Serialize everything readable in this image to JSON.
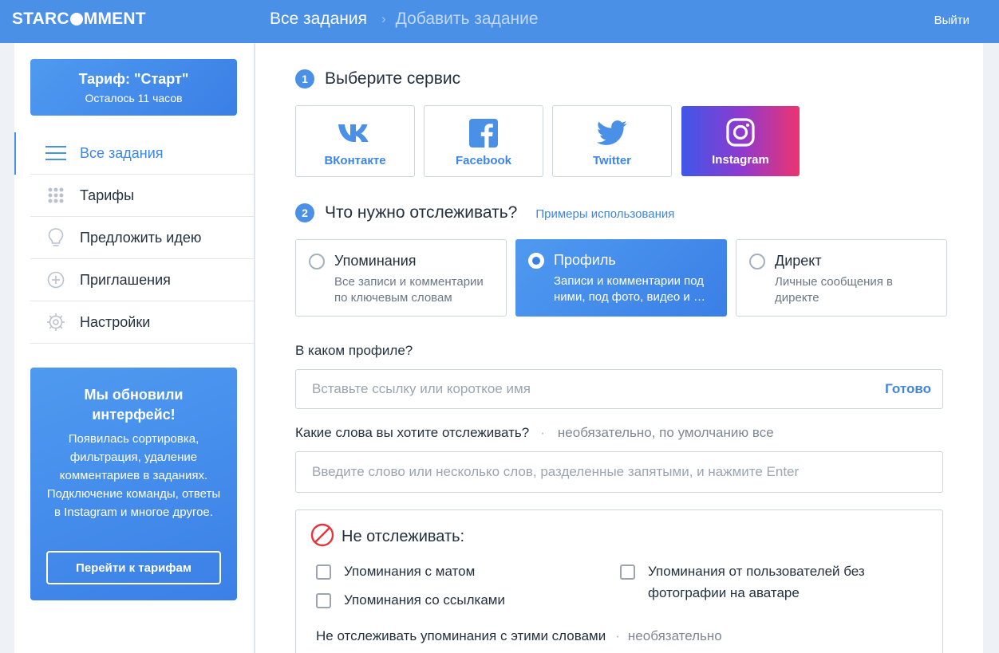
{
  "app": {
    "logo_left": "STARC",
    "logo_right": "MMENT",
    "logout": "Выйти"
  },
  "breadcrumb": {
    "root": "Все задания",
    "separator": "›",
    "current": "Добавить задание"
  },
  "sidebar": {
    "plan": {
      "title": "Тариф: \"Старт\"",
      "remaining": "Осталось 11 часов"
    },
    "items": [
      {
        "label": "Все задания",
        "icon": "menu-icon",
        "active": true
      },
      {
        "label": "Тарифы",
        "icon": "grid-icon",
        "active": false
      },
      {
        "label": "Предложить идею",
        "icon": "lightbulb-icon",
        "active": false
      },
      {
        "label": "Приглашения",
        "icon": "plus-circle-icon",
        "active": false
      },
      {
        "label": "Настройки",
        "icon": "gear-icon",
        "active": false
      }
    ],
    "promo": {
      "title": "Мы обновили интерфейс!",
      "text": "Появилась сортировка, фильтрация, удаление комментариев в заданиях. Подключение команды, ответы в Instagram и многое другое.",
      "button": "Перейти к тарифам"
    }
  },
  "step1": {
    "number": "1",
    "title": "Выберите сервис",
    "services": [
      {
        "label": "ВКонтакте",
        "icon": "vk-icon",
        "selected": false
      },
      {
        "label": "Facebook",
        "icon": "facebook-icon",
        "selected": false
      },
      {
        "label": "Twitter",
        "icon": "twitter-icon",
        "selected": false
      },
      {
        "label": "Instagram",
        "icon": "instagram-icon",
        "selected": true
      }
    ]
  },
  "step2": {
    "number": "2",
    "title": "Что нужно отслеживать?",
    "examples_link": "Примеры использования",
    "modes": [
      {
        "title": "Упоминания",
        "desc": "Все записи и комментарии по ключевым словам",
        "selected": false
      },
      {
        "title": "Профиль",
        "desc_line1": "Записи и комментарии под",
        "desc_line2": "ними, под фото, видео и …",
        "selected": true
      },
      {
        "title": "Директ",
        "desc": "Личные сообщения в директе",
        "selected": false
      }
    ]
  },
  "profile": {
    "label": "В каком профиле?",
    "placeholder": "Вставьте ссылку или короткое имя",
    "done": "Готово"
  },
  "keywords": {
    "label": "Какие слова вы хотите отслеживать?",
    "separator": "·",
    "optional": "необязательно, по умолчанию все",
    "placeholder": "Введите слово или несколько слов, разделенные запятыми, и нажмите Enter"
  },
  "exclude": {
    "title": "Не отслеживать:",
    "options": [
      {
        "label": "Упоминания с матом",
        "checked": false
      },
      {
        "label": "Упоминания со ссылками",
        "checked": false
      },
      {
        "label": "Упоминания от пользователей без фотографии на аватаре",
        "checked": false
      }
    ],
    "words_label": "Не отслеживать упоминания с этими словами",
    "separator": "·",
    "optional": "необязательно"
  },
  "colors": {
    "accent": "#4a90e7",
    "link": "#3e86e2",
    "border": "#cdd5de",
    "instagram_gradient": [
      "#3f57e8",
      "#8d3ad0",
      "#ec3470"
    ],
    "forbidden": "#e8333a"
  }
}
